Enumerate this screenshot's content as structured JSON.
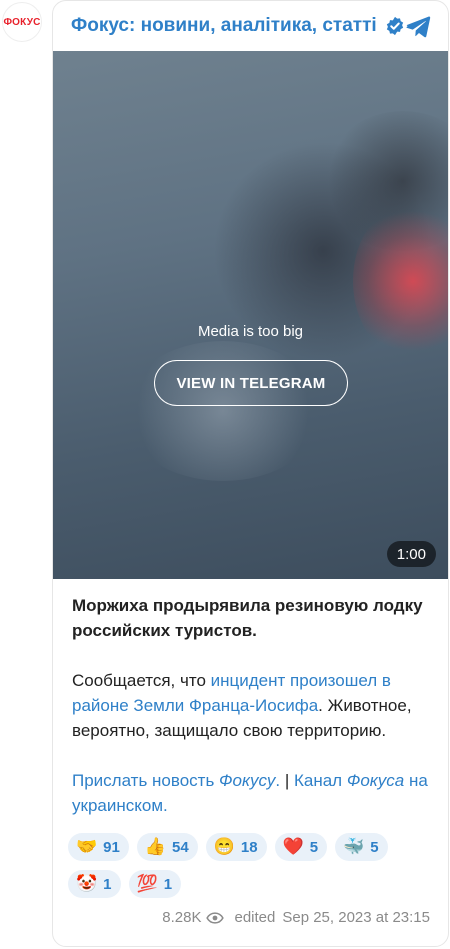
{
  "avatar": {
    "text": "ФОКУС"
  },
  "header": {
    "channel_name": "Фокус: новини, аналітика, статті"
  },
  "media": {
    "message": "Media is too big",
    "button_label": "VIEW IN TELEGRAM",
    "duration": "1:00"
  },
  "post": {
    "title": "Моржиха продырявила резиновую лодку российских туристов.",
    "p2_before": "Сообщается, что ",
    "p2_link": "инцидент произошел в районе Земли Франца-Иосифа",
    "p2_after": ". Животное, вероятно, защищало свою территорию.",
    "link1_a": "Прислать новость ",
    "link1_b": "Фокусу",
    "link1_c": ".",
    "separator": " | ",
    "link2_a": "Канал ",
    "link2_b": "Фокуса",
    "link2_c": " на украинском."
  },
  "reactions": [
    {
      "emoji": "🤝",
      "count": "91"
    },
    {
      "emoji": "👍",
      "count": "54"
    },
    {
      "emoji": "😁",
      "count": "18"
    },
    {
      "emoji": "❤️",
      "count": "5"
    },
    {
      "emoji": "🐳",
      "count": "5"
    },
    {
      "emoji": "🤡",
      "count": "1"
    },
    {
      "emoji": "💯",
      "count": "1"
    }
  ],
  "footer": {
    "views": "8.28K",
    "edited": "edited",
    "datetime": "Sep 25, 2023 at 23:15"
  },
  "colors": {
    "accent": "#2f80c8",
    "brand_red": "#e8212b",
    "reaction_bg": "#e9f1f9"
  }
}
